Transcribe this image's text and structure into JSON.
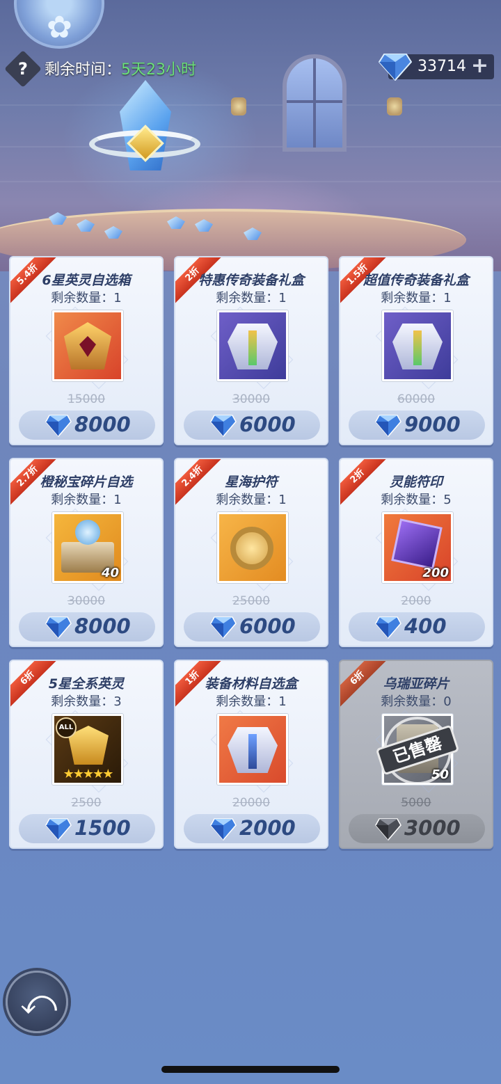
{
  "header": {
    "help_label": "?",
    "timer_label": "剩余时间：",
    "timer_value": "5天23小时",
    "currency_amount": "33714",
    "currency_plus": "+",
    "currency_icon": "diamond-icon"
  },
  "colors": {
    "timer_value": "#6be07a",
    "ribbon": "#e04a2e",
    "price_text": "#2d4a82"
  },
  "items": [
    {
      "name": "6星英灵自选箱",
      "discount": "5.4折",
      "remain_label": "剩余数量：",
      "remain": "1",
      "original_price": "15000",
      "price": "8000",
      "icon": "crimson-helmet-icon",
      "quantity": "",
      "sold_out": false
    },
    {
      "name": "特惠传奇装备礼盒",
      "discount": "2折",
      "remain_label": "剩余数量：",
      "remain": "1",
      "original_price": "30000",
      "price": "6000",
      "icon": "legendary-armor-box-icon",
      "quantity": "",
      "sold_out": false
    },
    {
      "name": "超值传奇装备礼盒",
      "discount": "1.5折",
      "remain_label": "剩余数量：",
      "remain": "1",
      "original_price": "60000",
      "price": "9000",
      "icon": "legendary-armor-box-icon",
      "quantity": "",
      "sold_out": false
    },
    {
      "name": "橙秘宝碎片自选",
      "discount": "2.7折",
      "remain_label": "剩余数量：",
      "remain": "1",
      "original_price": "30000",
      "price": "8000",
      "icon": "treasure-chest-icon",
      "quantity": "40",
      "sold_out": false
    },
    {
      "name": "星海护符",
      "discount": "2.4折",
      "remain_label": "剩余数量：",
      "remain": "1",
      "original_price": "25000",
      "price": "6000",
      "icon": "amulet-icon",
      "quantity": "",
      "sold_out": false
    },
    {
      "name": "灵能符印",
      "discount": "2折",
      "remain_label": "剩余数量：",
      "remain": "5",
      "original_price": "2000",
      "price": "400",
      "icon": "purple-rune-icon",
      "quantity": "200",
      "sold_out": false
    },
    {
      "name": "5星全系英灵",
      "discount": "6折",
      "remain_label": "剩余数量：",
      "remain": "3",
      "original_price": "2500",
      "price": "1500",
      "icon": "golden-mask-icon",
      "quantity": "",
      "badge": "ALL",
      "stars": "★★★★★",
      "sold_out": false
    },
    {
      "name": "装备材料自选盒",
      "discount": "1折",
      "remain_label": "剩余数量：",
      "remain": "1",
      "original_price": "20000",
      "price": "2000",
      "icon": "equipment-material-icon",
      "quantity": "",
      "sold_out": false
    },
    {
      "name": "乌瑞亚碎片",
      "discount": "6折",
      "remain_label": "剩余数量：",
      "remain": "0",
      "original_price": "5000",
      "price": "3000",
      "icon": "hero-shard-icon",
      "quantity": "50",
      "sold_out": true,
      "sold_label": "已售罄"
    }
  ],
  "footer": {
    "back_icon": "back-arrow-icon",
    "back_glyph": "⤺"
  }
}
